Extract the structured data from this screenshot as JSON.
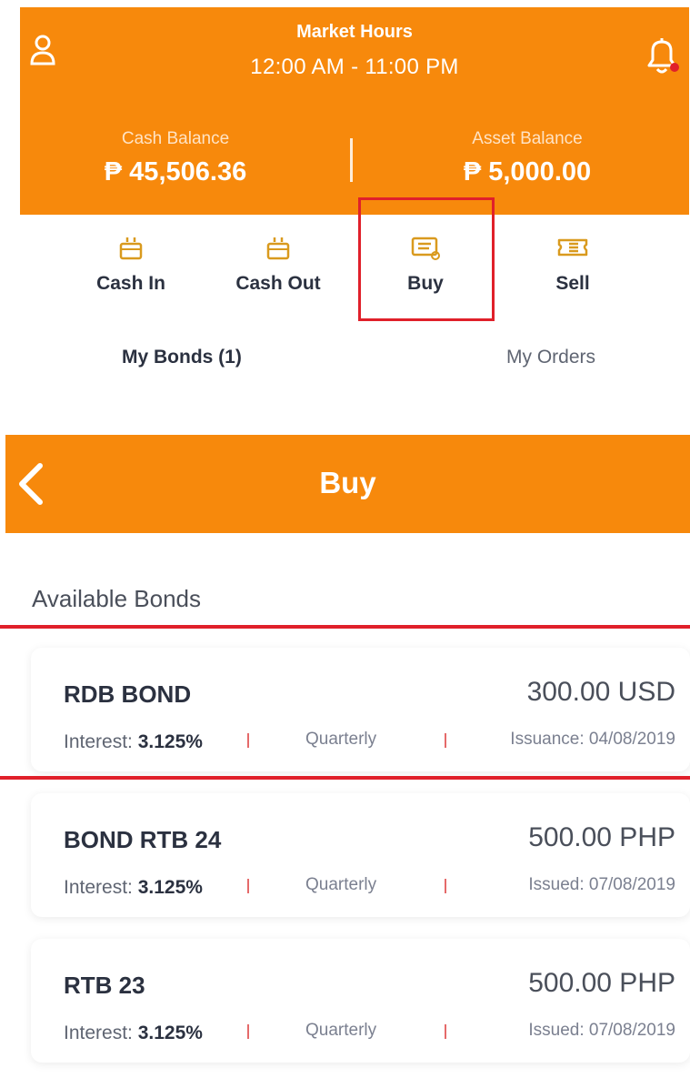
{
  "header": {
    "market_hours_title": "Market Hours",
    "market_hours_time": "12:00 AM - 11:00 PM",
    "cash_balance_label": "Cash Balance",
    "cash_balance_value": "₱ 45,506.36",
    "asset_balance_label": "Asset Balance",
    "asset_balance_value": "₱ 5,000.00",
    "profile_icon": "user-icon",
    "bell_icon": "bell-icon",
    "notification_dot_color": "#e0202a"
  },
  "actions": [
    {
      "label": "Cash In",
      "icon": "wallet-in-icon"
    },
    {
      "label": "Cash Out",
      "icon": "wallet-out-icon"
    },
    {
      "label": "Buy",
      "icon": "bond-certificate-icon"
    },
    {
      "label": "Sell",
      "icon": "ticket-icon"
    }
  ],
  "tabs": {
    "my_bonds": "My Bonds (1)",
    "my_orders": "My Orders"
  },
  "buy_page": {
    "title": "Buy",
    "back_icon": "chevron-left-icon",
    "section_title": "Available Bonds"
  },
  "bonds": [
    {
      "name": "RDB BOND",
      "price": "300.00 USD",
      "interest_label": "Interest:",
      "interest_value": "3.125%",
      "frequency": "Quarterly",
      "date": "Issuance: 04/08/2019"
    },
    {
      "name": "BOND RTB 24",
      "price": "500.00 PHP",
      "interest_label": "Interest:",
      "interest_value": "3.125%",
      "frequency": "Quarterly",
      "date": "Issued: 07/08/2019"
    },
    {
      "name": "RTB 23",
      "price": "500.00 PHP",
      "interest_label": "Interest:",
      "interest_value": "3.125%",
      "frequency": "Quarterly",
      "date": "Issued: 07/08/2019"
    }
  ],
  "colors": {
    "brand_orange": "#f7890c",
    "highlight_red": "#e0202a",
    "text_dark": "#2b3140",
    "icon_gold": "#d99a1e"
  }
}
